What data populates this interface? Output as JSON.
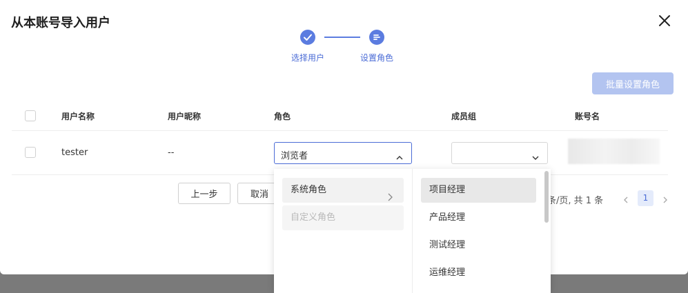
{
  "dialog": {
    "title": "从本账号导入用户"
  },
  "steps": [
    {
      "label": "选择用户",
      "status": "done"
    },
    {
      "label": "设置角色",
      "status": "current"
    }
  ],
  "toolbar": {
    "batch_label": "批量设置角色"
  },
  "table": {
    "headers": [
      "用户名称",
      "用户昵称",
      "角色",
      "成员组",
      "账号名"
    ],
    "rows": [
      {
        "username": "tester",
        "nickname": "--",
        "role": "浏览者",
        "group": "",
        "account": ""
      }
    ]
  },
  "footer": {
    "prev_label": "上一步",
    "cancel_label": "取消",
    "pager_text": "条/页, 共 1 条",
    "current_page": "1"
  },
  "dropdown": {
    "categories": [
      {
        "label": "系统角色",
        "state": "active"
      },
      {
        "label": "自定义角色",
        "state": "disabled"
      }
    ],
    "options": [
      "项目经理",
      "产品经理",
      "测试经理",
      "运维经理"
    ]
  },
  "colors": {
    "primary": "#4a6bd6",
    "step": "#5b7ce0",
    "batch_disabled": "#b3c4f0"
  }
}
